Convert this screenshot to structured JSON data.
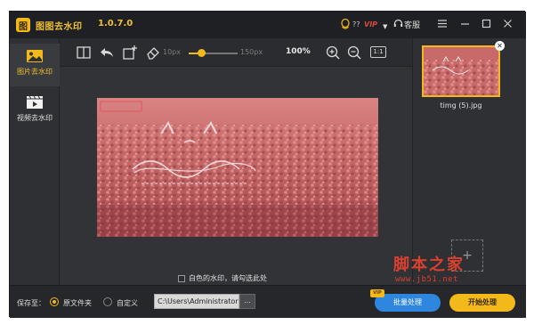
{
  "app": {
    "title": "图图去水印",
    "version": "1.0.7.0",
    "titlebar_q": "??",
    "titlebar_vip": "VIP",
    "kefu_label": "客服"
  },
  "sidenav": {
    "items": [
      {
        "label": "图片去水印",
        "active": true
      },
      {
        "label": "视频去水印",
        "active": false
      }
    ]
  },
  "toolbar": {
    "brush_min": "10px",
    "brush_max": "150px",
    "brush_level": 0.25,
    "zoom": "100%",
    "one_to_one": "1:1"
  },
  "canvas": {
    "watermark_hint": "白色的水印，请勾选此处"
  },
  "files": {
    "items": [
      {
        "name": "timg (5).jpg"
      }
    ]
  },
  "bottom": {
    "save_label": "保存至：",
    "radio_original": "原文件夹",
    "radio_custom": "自定义",
    "path": "C:\\Users\\Administrator",
    "browse": "...",
    "vip_tag": "VIP",
    "batch_button": "批量处理",
    "start_button": "开始处理"
  },
  "overlay": {
    "site_name": "脚本之家",
    "site_url": "www.jb51.net"
  },
  "colors": {
    "accent": "#f3b81a",
    "batch": "#2e86de",
    "window_bg": "#2b2c2f"
  }
}
